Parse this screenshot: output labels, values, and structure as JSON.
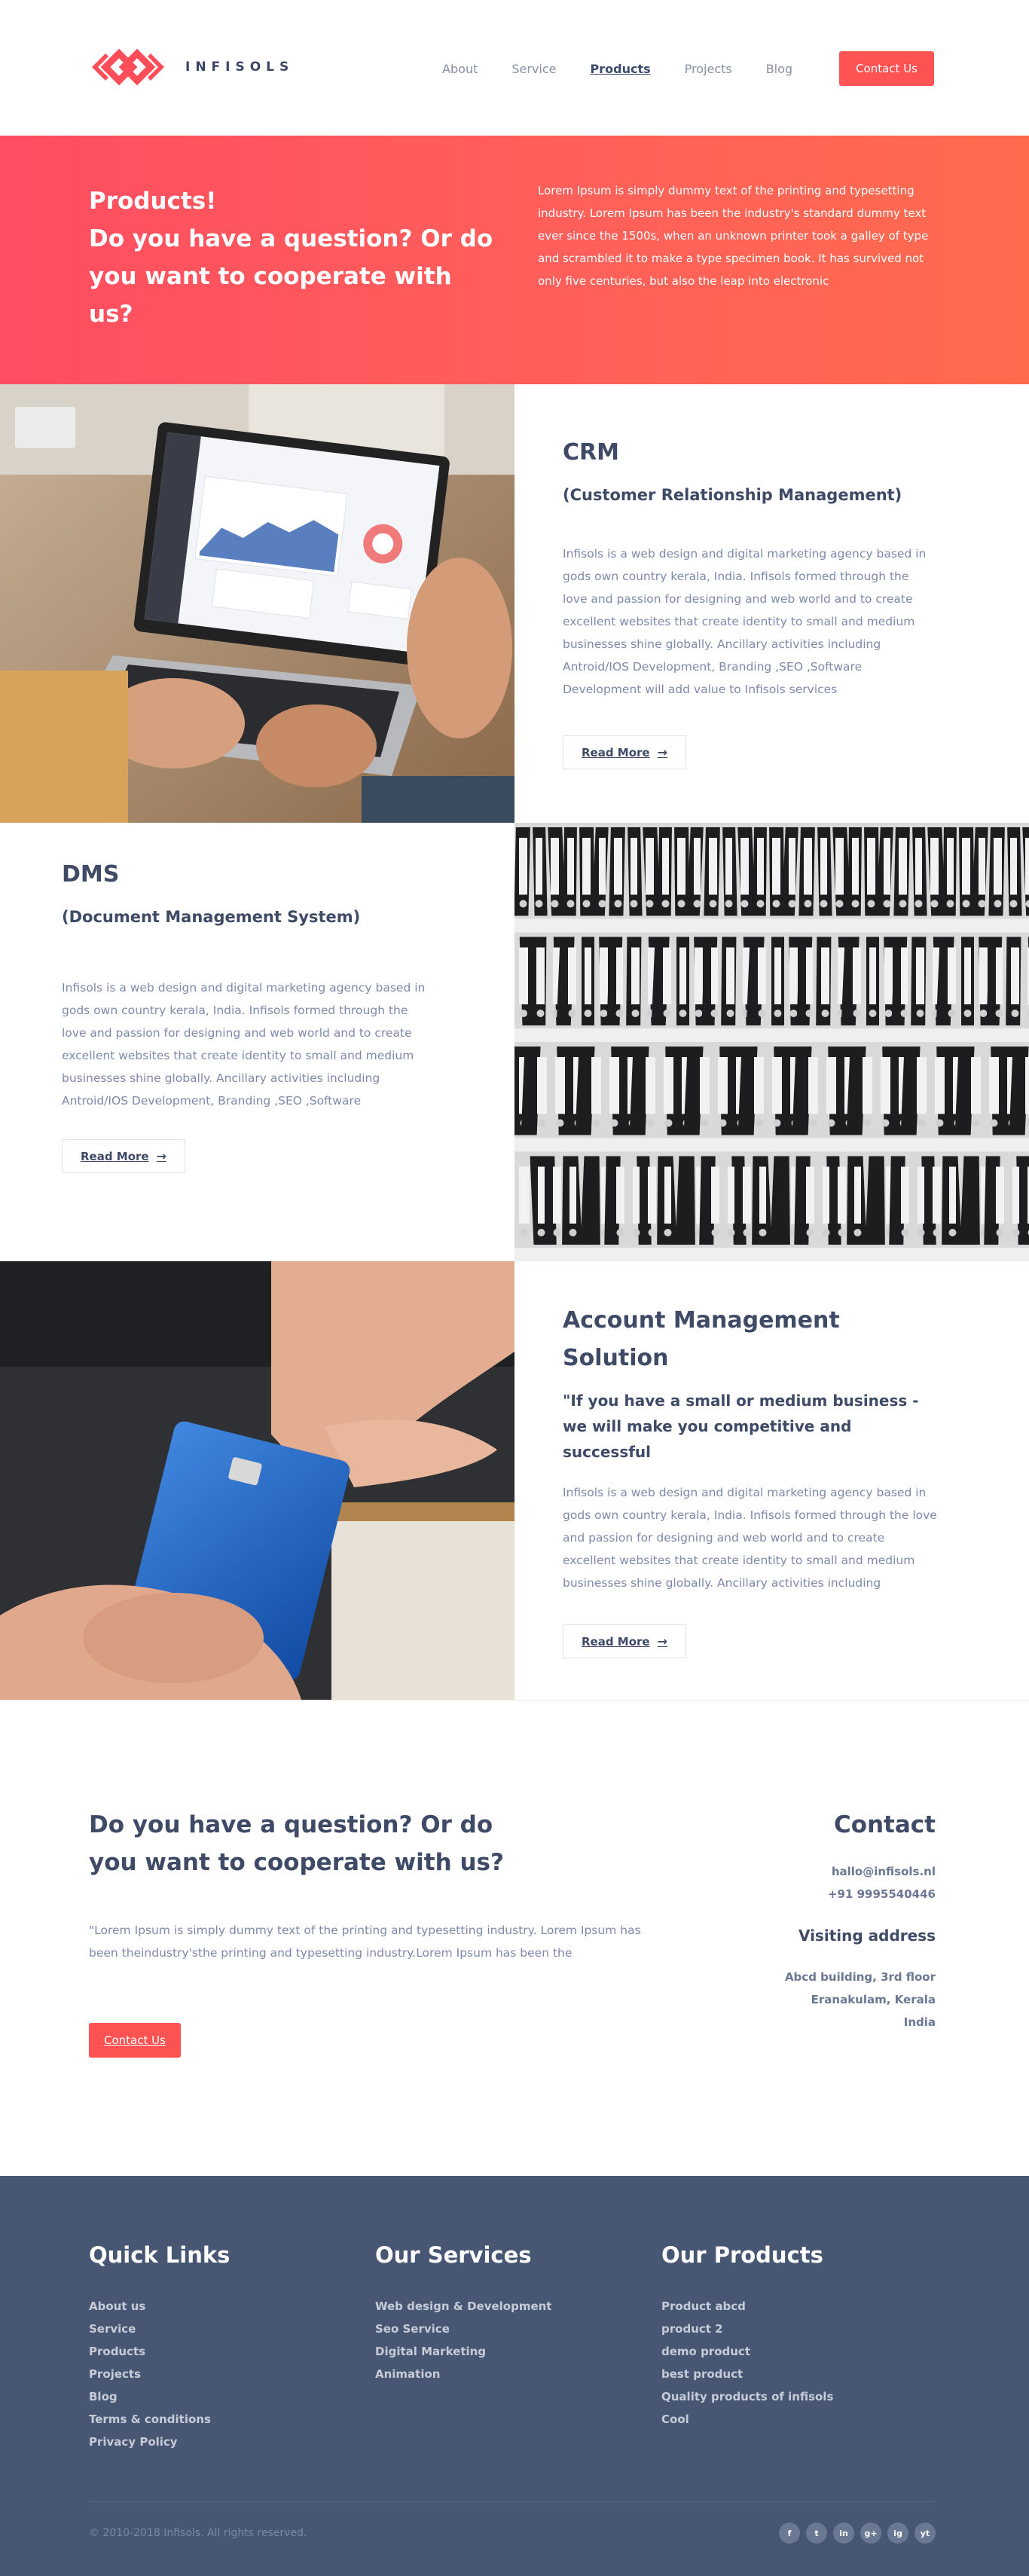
{
  "brand": {
    "name": "INFISOLS"
  },
  "nav": {
    "items": [
      "About",
      "Service",
      "Products",
      "Projects",
      "Blog"
    ],
    "active": "Products",
    "contact_label": "Contact Us"
  },
  "hero": {
    "title": "Products! Do you have a question? Or do you want to cooperate with us?",
    "title_line1": "Products!",
    "title_line2": "Do you have a question? Or do",
    "title_line3": "you want to cooperate with us?",
    "text": "Lorem Ipsum is simply dummy text of the printing and typesetting industry. Lorem Ipsum has been the industry's standard dummy text ever since the 1500s, when an unknown printer took a galley of type and scrambled it to make a type specimen book. It has survived not only five centuries, but also the leap into electronic"
  },
  "products": [
    {
      "title": "CRM",
      "subtitle": "(Customer Relationship Management)",
      "description": "Infisols is a web design and digital marketing agency based in gods own country kerala, India. Infisols formed through the love and passion for designing and web world and to create excellent websites that create identity to small and medium businesses shine globally. Ancillary activities including Antroid/IOS Development, Branding ,SEO ,Software Development will add value to Infisols services",
      "read_more": "Read More"
    },
    {
      "title": "DMS",
      "subtitle": "(Document Management System)",
      "description": "Infisols is a web design and digital marketing agency based in gods own country kerala, India. Infisols formed through the love and passion for designing and web world and to create excellent websites that create identity to small and medium businesses shine globally. Ancillary activities including Antroid/IOS Development, Branding ,SEO ,Software",
      "read_more": "Read More"
    },
    {
      "title": "Account Management Solution",
      "subtitle": "\"If you have a small or medium business - we will make you competitive and successful",
      "description": "Infisols is a web design and digital marketing agency based in gods own country kerala, India. Infisols formed through the love and passion for designing and web world and to create excellent websites that create identity to small and medium businesses shine globally. Ancillary activities including",
      "read_more": "Read More"
    }
  ],
  "contact_section": {
    "title": "Do you have a question? Or do you want to cooperate with us?",
    "text": "\"Lorem Ipsum is simply dummy text of the printing and typesetting industry. Lorem Ipsum has been theindustry'sthe printing and typesetting industry.Lorem Ipsum has been the",
    "button": "Contact Us",
    "contact_title": "Contact",
    "email": "hallo@infisols.nl",
    "phone": "+91  9995540446",
    "visiting_title": "Visiting address",
    "address_line1": "Abcd building, 3rd floor",
    "address_line2": "Eranakulam, Kerala",
    "address_line3": "India"
  },
  "footer": {
    "quick_links_title": "Quick Links",
    "quick_links": [
      "About us",
      "Service",
      "Products",
      "Projects",
      "Blog",
      "Terms & conditions",
      "Privacy Policy"
    ],
    "services_title": "Our Services",
    "services": [
      "Web design & Development",
      "Seo Service",
      "Digital Marketing",
      "Animation"
    ],
    "products_title": "Our Products",
    "products": [
      "Product abcd",
      "product 2",
      "demo product",
      "best product",
      "Quality products of infisols",
      "Cool"
    ],
    "copyright": "©  2010-2018 Infisols. All rights reserved.",
    "social": [
      "f",
      "t",
      "in",
      "g+",
      "ig",
      "yt"
    ]
  },
  "colors": {
    "accent": "#ff5252",
    "hero_start": "#ff4d61",
    "hero_end": "#ff6b4d",
    "footer_bg": "#475672",
    "heading": "#3e4a66"
  }
}
